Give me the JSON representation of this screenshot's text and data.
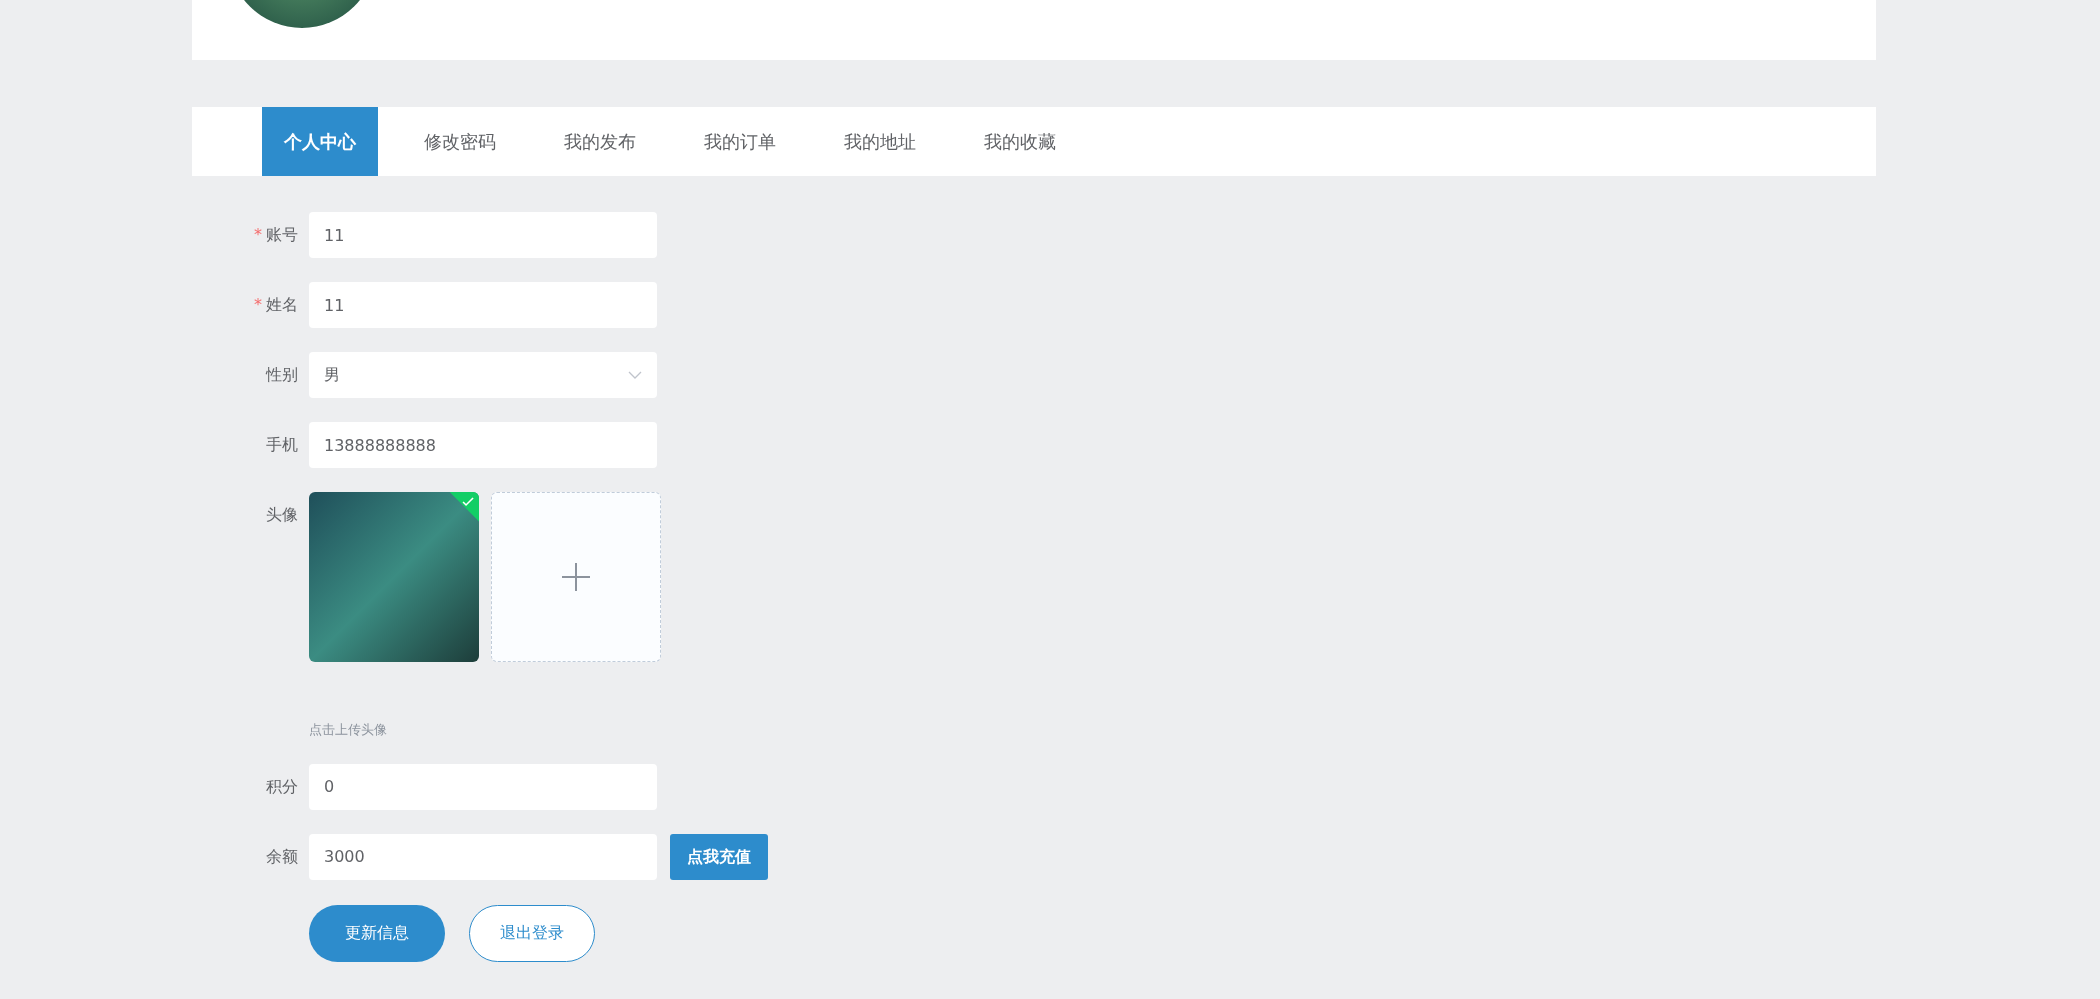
{
  "tabs": [
    {
      "label": "个人中心",
      "selected": true
    },
    {
      "label": "修改密码",
      "selected": false
    },
    {
      "label": "我的发布",
      "selected": false
    },
    {
      "label": "我的订单",
      "selected": false
    },
    {
      "label": "我的地址",
      "selected": false
    },
    {
      "label": "我的收藏",
      "selected": false
    }
  ],
  "form": {
    "fields": [
      {
        "kind": "text",
        "label": "账号",
        "marker": "*",
        "value": "11"
      },
      {
        "kind": "text",
        "label": "姓名",
        "marker": "*",
        "value": "11"
      },
      {
        "kind": "select",
        "label": "性别",
        "value": "男"
      },
      {
        "kind": "text",
        "label": "手机",
        "value": "13888888888"
      },
      {
        "kind": "upload",
        "label": "头像",
        "uploaded": true,
        "hint": "点击上传头像"
      },
      {
        "kind": "text",
        "label": "积分",
        "value": "0"
      },
      {
        "kind": "text",
        "label": "余额",
        "value": "3000",
        "action": "点我充值"
      }
    ],
    "buttons": [
      {
        "label": "更新信息",
        "kind": "primary"
      },
      {
        "label": "退出登录",
        "kind": "outline"
      }
    ]
  }
}
